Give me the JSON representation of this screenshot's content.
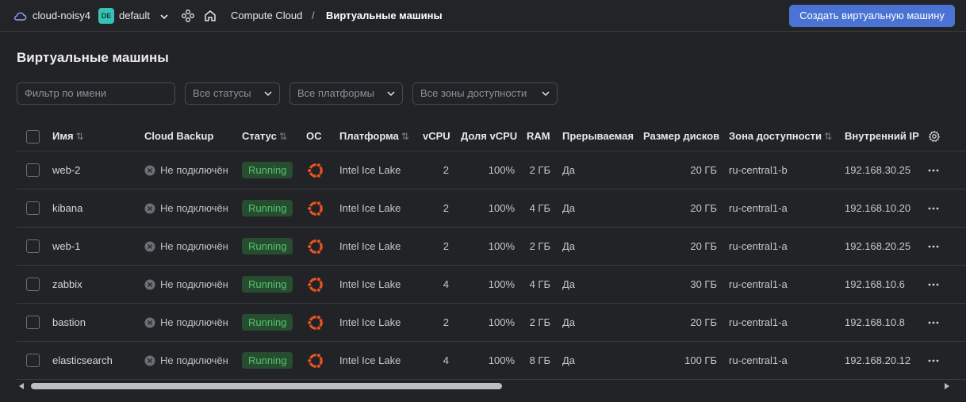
{
  "topbar": {
    "cloud_name": "cloud-noisy4",
    "folder_badge": "DE",
    "folder_name": "default",
    "breadcrumb_service": "Compute Cloud",
    "breadcrumb_separator": "/",
    "breadcrumb_current": "Виртуальные машины",
    "create_button": "Создать виртуальную машину",
    "icons": [
      "cloud-icon",
      "chevron-down-icon",
      "nodes-icon",
      "home-icon"
    ]
  },
  "page": {
    "title": "Виртуальные машины"
  },
  "filters": {
    "name_placeholder": "Фильтр по имени",
    "status": "Все статусы",
    "platform": "Все платформы",
    "zone": "Все зоны доступности"
  },
  "table": {
    "columns": {
      "name": "Имя",
      "backup": "Cloud Backup",
      "status": "Статус",
      "os": "ОС",
      "platform": "Платформа",
      "vcpu": "vCPU",
      "share": "Доля vCPU",
      "ram": "RAM",
      "preempt": "Прерываемая",
      "disk": "Размер дисков",
      "zone": "Зона доступности",
      "ip": "Внутренний IP",
      "sort_glyph": "⇅"
    },
    "rows": [
      {
        "name": "web-2",
        "backup": "Не подключён",
        "status": "Running",
        "os_icon": "ubuntu-icon",
        "platform": "Intel Ice Lake",
        "vcpu": "2",
        "share": "100%",
        "ram": "2 ГБ",
        "preempt": "Да",
        "disk": "20 ГБ",
        "zone": "ru-central1-b",
        "ip": "192.168.30.25"
      },
      {
        "name": "kibana",
        "backup": "Не подключён",
        "status": "Running",
        "os_icon": "ubuntu-icon",
        "platform": "Intel Ice Lake",
        "vcpu": "2",
        "share": "100%",
        "ram": "4 ГБ",
        "preempt": "Да",
        "disk": "20 ГБ",
        "zone": "ru-central1-a",
        "ip": "192.168.10.20"
      },
      {
        "name": "web-1",
        "backup": "Не подключён",
        "status": "Running",
        "os_icon": "ubuntu-icon",
        "platform": "Intel Ice Lake",
        "vcpu": "2",
        "share": "100%",
        "ram": "2 ГБ",
        "preempt": "Да",
        "disk": "20 ГБ",
        "zone": "ru-central1-a",
        "ip": "192.168.20.25"
      },
      {
        "name": "zabbix",
        "backup": "Не подключён",
        "status": "Running",
        "os_icon": "ubuntu-icon",
        "platform": "Intel Ice Lake",
        "vcpu": "4",
        "share": "100%",
        "ram": "4 ГБ",
        "preempt": "Да",
        "disk": "30 ГБ",
        "zone": "ru-central1-a",
        "ip": "192.168.10.6"
      },
      {
        "name": "bastion",
        "backup": "Не подключён",
        "status": "Running",
        "os_icon": "ubuntu-icon",
        "platform": "Intel Ice Lake",
        "vcpu": "2",
        "share": "100%",
        "ram": "2 ГБ",
        "preempt": "Да",
        "disk": "20 ГБ",
        "zone": "ru-central1-a",
        "ip": "192.168.10.8"
      },
      {
        "name": "elasticsearch",
        "backup": "Не подключён",
        "status": "Running",
        "os_icon": "ubuntu-icon",
        "platform": "Intel Ice Lake",
        "vcpu": "4",
        "share": "100%",
        "ram": "8 ГБ",
        "preempt": "Да",
        "disk": "100 ГБ",
        "zone": "ru-central1-a",
        "ip": "192.168.20.12"
      }
    ]
  },
  "colors": {
    "background": "#222326",
    "accent": "#4b73d4",
    "running_bg": "#264d2f",
    "running_text": "#55c36d",
    "ubuntu": "#e95420",
    "folder_badge": "#34c3b6"
  }
}
